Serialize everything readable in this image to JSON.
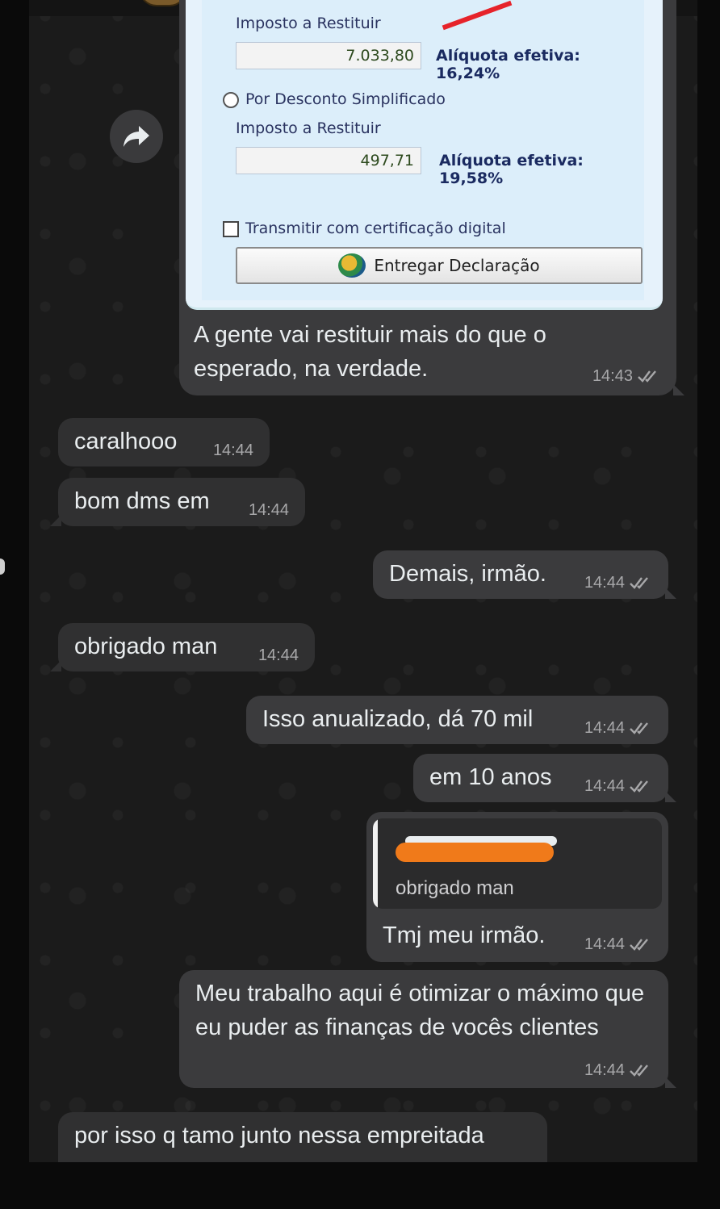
{
  "screenshot_image": {
    "imposto_label_1": "Imposto a Restituir",
    "value_1": "7.033,80",
    "aliquota_1": "Alíquota efetiva: 16,24%",
    "option_simplificado": "Por Desconto Simplificado",
    "imposto_label_2": "Imposto a Restituir",
    "value_2": "497,71",
    "aliquota_2": "Alíquota efetiva: 19,58%",
    "checkbox_label": "Transmitir com certificação digital",
    "button_label": "Entregar Declaração"
  },
  "messages": [
    {
      "dir": "out",
      "text": "A gente vai restituir mais do que o esperado, na verdade.",
      "time": "14:43"
    },
    {
      "dir": "in",
      "text": "caralhooo",
      "time": "14:44"
    },
    {
      "dir": "in",
      "text": "bom dms em",
      "time": "14:44"
    },
    {
      "dir": "out",
      "text": "Demais, irmão.",
      "time": "14:44"
    },
    {
      "dir": "in",
      "text": "obrigado man",
      "time": "14:44"
    },
    {
      "dir": "out",
      "text": "Isso anualizado, dá 70 mil",
      "time": "14:44"
    },
    {
      "dir": "out",
      "text": "em 10 anos",
      "time": "14:44"
    },
    {
      "dir": "out",
      "text": "Tmj meu irmão.",
      "time": "14:44",
      "quoted_text": "obrigado man"
    },
    {
      "dir": "out",
      "text": "Meu trabalho aqui é otimizar o máximo que eu puder as finanças de vocês clientes",
      "time": "14:44"
    },
    {
      "dir": "in",
      "text": "por isso q tamo junto nessa empreitada",
      "time": ""
    }
  ],
  "icons": {
    "forward": "forward-arrow-icon",
    "read_receipt": "double-check-icon"
  },
  "colors": {
    "bubble_out": "#3b3b3d",
    "bubble_in": "#303031",
    "chat_bg": "#1b1b1b"
  }
}
